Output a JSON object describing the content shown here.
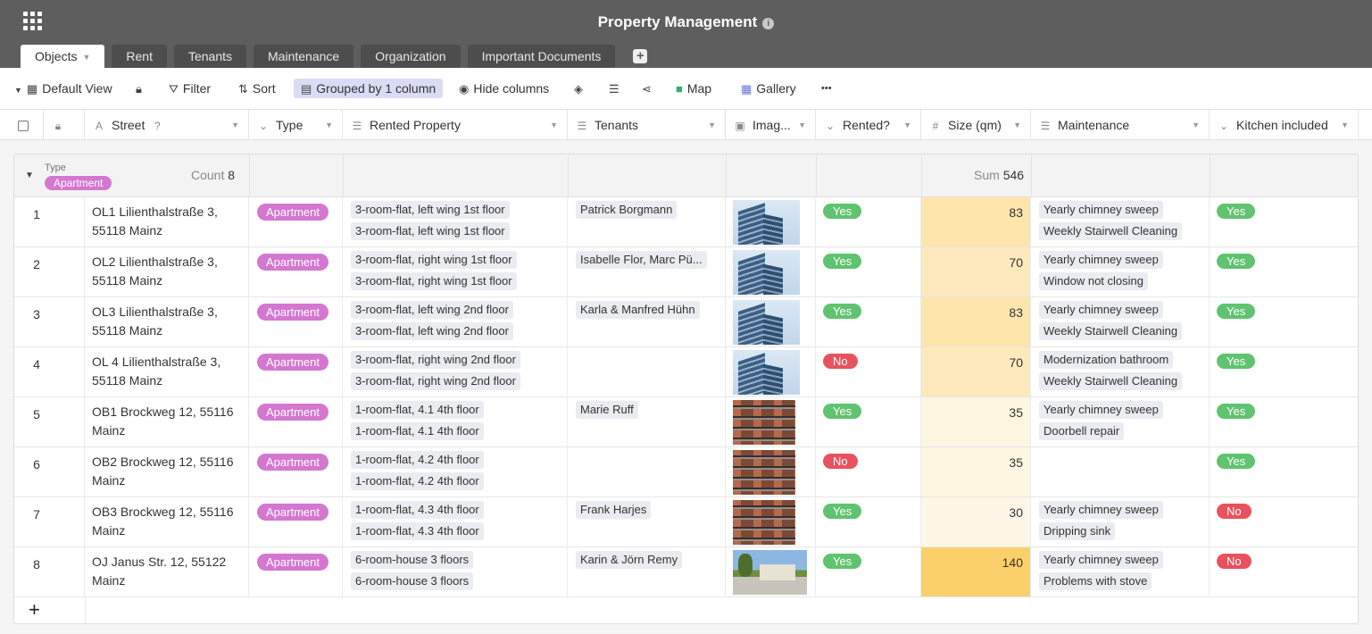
{
  "app": {
    "title": "Property Management"
  },
  "tabs": [
    {
      "label": "Objects"
    },
    {
      "label": "Rent"
    },
    {
      "label": "Tenants"
    },
    {
      "label": "Maintenance"
    },
    {
      "label": "Organization"
    },
    {
      "label": "Important Documents"
    }
  ],
  "toolbar": {
    "view_label": "Default View",
    "filter_label": "Filter",
    "sort_label": "Sort",
    "grouped_label": "Grouped by 1 column",
    "hide_label": "Hide columns",
    "map_label": "Map",
    "gallery_label": "Gallery",
    "more_label": "•••"
  },
  "columns": {
    "street": "Street",
    "type": "Type",
    "rented_property": "Rented Property",
    "tenants": "Tenants",
    "image": "Imag...",
    "rented": "Rented?",
    "size": "Size (qm)",
    "maintenance": "Maintenance",
    "kitchen": "Kitchen included"
  },
  "group": {
    "label": "Type",
    "value": "Apartment",
    "count_label": "Count",
    "count": "8",
    "sum_label": "Sum",
    "sum": "546"
  },
  "rows": [
    {
      "num": "1",
      "street": "OL1 Lilienthalstraße 3, 55118 Mainz",
      "type": "Apartment",
      "rented_property": [
        "3-room-flat, left wing 1st floor",
        "3-room-flat, left wing 1st floor"
      ],
      "tenants": "Patrick Borgmann",
      "image": "building-photo",
      "rented": "Yes",
      "size": "83",
      "maintenance": [
        "Yearly chimney sweep",
        "Weekly Stairwell Cleaning"
      ],
      "kitchen": "Yes"
    },
    {
      "num": "2",
      "street": "OL2 Lilienthalstraße 3, 55118 Mainz",
      "type": "Apartment",
      "rented_property": [
        "3-room-flat, right wing 1st floor",
        "3-room-flat, right wing 1st floor"
      ],
      "tenants": "Isabelle Flor, Marc Pü...",
      "image": "building-photo",
      "rented": "Yes",
      "size": "70",
      "maintenance": [
        "Yearly chimney sweep",
        "Window not closing"
      ],
      "kitchen": "Yes"
    },
    {
      "num": "3",
      "street": "OL3 Lilienthalstraße 3, 55118 Mainz",
      "type": "Apartment",
      "rented_property": [
        "3-room-flat, left wing 2nd floor",
        "3-room-flat, left wing 2nd floor"
      ],
      "tenants": "Karla & Manfred Hühn",
      "image": "building-photo",
      "rented": "Yes",
      "size": "83",
      "maintenance": [
        "Yearly chimney sweep",
        "Weekly Stairwell Cleaning"
      ],
      "kitchen": "Yes"
    },
    {
      "num": "4",
      "street": "OL 4 Lilienthalstraße 3, 55118 Mainz",
      "type": "Apartment",
      "rented_property": [
        "3-room-flat, right wing 2nd floor",
        "3-room-flat, right wing 2nd floor"
      ],
      "tenants": "",
      "image": "building-photo",
      "rented": "No",
      "size": "70",
      "maintenance": [
        "Modernization bathroom",
        "Weekly Stairwell Cleaning"
      ],
      "kitchen": "Yes"
    },
    {
      "num": "5",
      "street": "OB1 Brockweg 12, 55116 Mainz",
      "type": "Apartment",
      "rented_property": [
        "1-room-flat, 4.1 4th floor",
        "1-room-flat, 4.1 4th floor"
      ],
      "tenants": "Marie Ruff",
      "image": "brick-building-photo",
      "rented": "Yes",
      "size": "35",
      "maintenance": [
        "Yearly chimney sweep",
        "Doorbell repair"
      ],
      "kitchen": "Yes"
    },
    {
      "num": "6",
      "street": "OB2 Brockweg 12, 55116 Mainz",
      "type": "Apartment",
      "rented_property": [
        "1-room-flat, 4.2 4th floor",
        "1-room-flat, 4.2 4th floor"
      ],
      "tenants": "",
      "image": "brick-building-photo",
      "rented": "No",
      "size": "35",
      "maintenance": [],
      "kitchen": "Yes"
    },
    {
      "num": "7",
      "street": "OB3 Brockweg 12, 55116 Mainz",
      "type": "Apartment",
      "rented_property": [
        "1-room-flat, 4.3 4th floor",
        "1-room-flat, 4.3 4th floor"
      ],
      "tenants": "Frank Harjes",
      "image": "brick-building-photo",
      "rented": "Yes",
      "size": "30",
      "maintenance": [
        "Yearly chimney sweep",
        "Dripping sink"
      ],
      "kitchen": "No"
    },
    {
      "num": "8",
      "street": "OJ Janus Str. 12, 55122 Mainz",
      "type": "Apartment",
      "rented_property": [
        "6-room-house 3 floors",
        "6-room-house 3 floors"
      ],
      "tenants": "Karin & Jörn Remy",
      "image": "house-photo",
      "rented": "Yes",
      "size": "140",
      "maintenance": [
        "Yearly chimney sweep",
        "Problems with stove"
      ],
      "kitchen": "No"
    }
  ],
  "colors": {
    "header_bg": "#5e5e5e",
    "type_pill": "#d477d0",
    "yes": "#5fc36f",
    "no": "#e8525f",
    "size_heat": "#fbd06a"
  }
}
